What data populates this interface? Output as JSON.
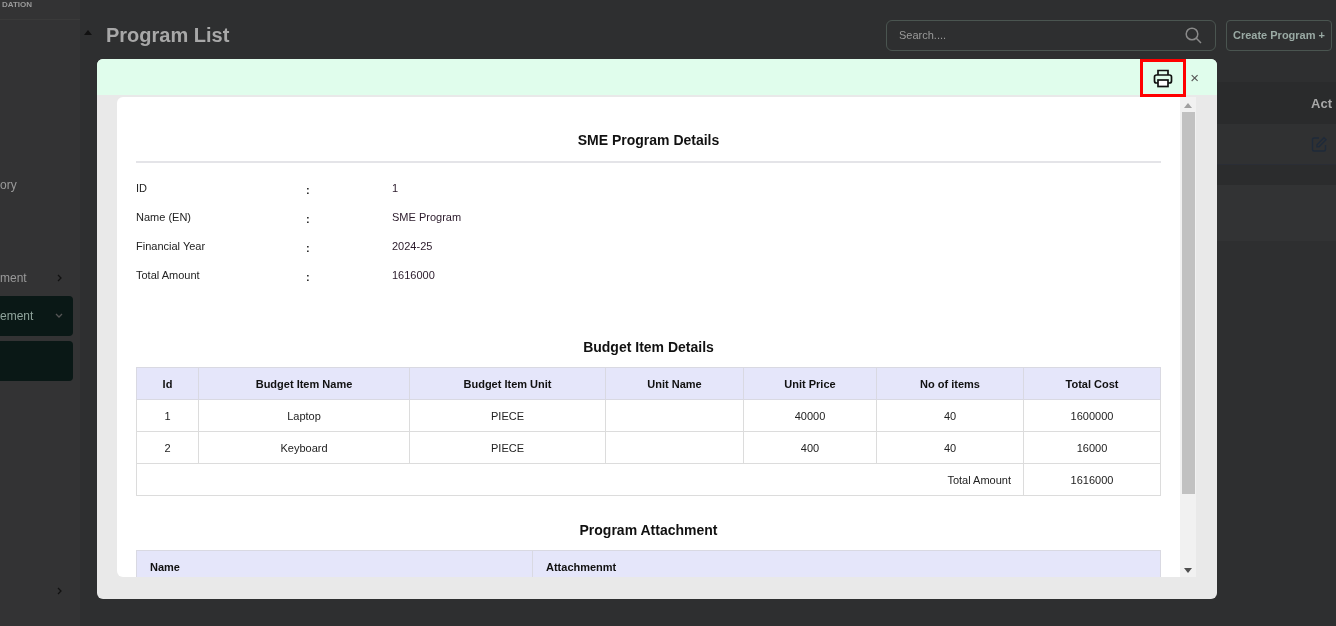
{
  "sidebar": {
    "brand": "DATION",
    "items": [
      {
        "kind": "plain",
        "label": "ory",
        "selected": false
      },
      {
        "kind": "expandable",
        "label": "ment",
        "selected": false
      },
      {
        "kind": "expanded",
        "label": "ement",
        "selected": true
      },
      {
        "kind": "sub",
        "selected": true
      },
      {
        "kind": "expandable",
        "selected": false
      }
    ]
  },
  "page": {
    "title": "Program List",
    "search": {
      "placeholder": "Search...."
    },
    "create_button": "Create Program +",
    "table": {
      "column_last": "Act"
    }
  },
  "modal": {
    "close": "×",
    "details": {
      "title": "SME Program Details",
      "fields": [
        {
          "label": "ID",
          "separator": ":",
          "value": "1"
        },
        {
          "label": "Name (EN)",
          "separator": ":",
          "value": "SME Program"
        },
        {
          "label": "Financial Year",
          "separator": ":",
          "value": "2024-25"
        },
        {
          "label": "Total Amount",
          "separator": ":",
          "value": "1616000"
        }
      ]
    },
    "budget": {
      "title": "Budget Item Details",
      "columns": [
        "Id",
        "Budget Item Name",
        "Budget Item Unit",
        "Unit Name",
        "Unit Price",
        "No of items",
        "Total Cost"
      ],
      "rows": [
        [
          "1",
          "Laptop",
          "PIECE",
          "",
          "40000",
          "40",
          "1600000"
        ],
        [
          "2",
          "Keyboard",
          "PIECE",
          "",
          "400",
          "40",
          "16000"
        ]
      ],
      "total_label": "Total Amount",
      "total_value": "1616000"
    },
    "attachment": {
      "title": "Program Attachment",
      "columns": [
        "Name",
        "Attachmenmt"
      ]
    }
  }
}
